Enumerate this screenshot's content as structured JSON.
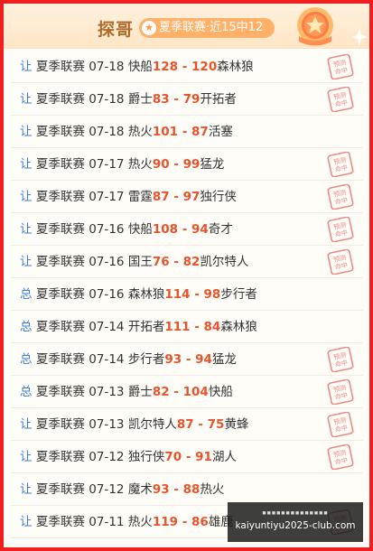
{
  "header": {
    "title": "探哥",
    "badge_text": "夏季联赛·近15中12",
    "colors": {
      "accent": "#ffb16a",
      "title": "#b06a2a",
      "score": "#e8532b",
      "tag": "#3d7dd6",
      "frame": "#f01e1e"
    }
  },
  "rows": [
    {
      "tag": "让",
      "league": "夏季联赛",
      "date": "07-18",
      "home": "快船",
      "home_score": "128",
      "sep": " - ",
      "away_score": "120",
      "away": "森林狼",
      "hit": true
    },
    {
      "tag": "让",
      "league": "夏季联赛",
      "date": "07-18",
      "home": "爵士",
      "home_score": "83",
      "sep": " - ",
      "away_score": "79",
      "away": "开拓者",
      "hit": true
    },
    {
      "tag": "让",
      "league": "夏季联赛",
      "date": "07-18",
      "home": "热火",
      "home_score": "101",
      "sep": " - ",
      "away_score": "87",
      "away": "活塞",
      "hit": false
    },
    {
      "tag": "让",
      "league": "夏季联赛",
      "date": "07-17",
      "home": "热火",
      "home_score": "90",
      "sep": " - ",
      "away_score": "99",
      "away": "猛龙",
      "hit": true
    },
    {
      "tag": "让",
      "league": "夏季联赛",
      "date": "07-17",
      "home": "雷霆",
      "home_score": "87",
      "sep": " - ",
      "away_score": "97",
      "away": "独行侠",
      "hit": true
    },
    {
      "tag": "让",
      "league": "夏季联赛",
      "date": "07-16",
      "home": "快船",
      "home_score": "108",
      "sep": " - ",
      "away_score": "94",
      "away": "奇才",
      "hit": true
    },
    {
      "tag": "让",
      "league": "夏季联赛",
      "date": "07-16",
      "home": "国王",
      "home_score": "76",
      "sep": " - ",
      "away_score": "82",
      "away": "凯尔特人",
      "hit": true
    },
    {
      "tag": "总",
      "league": "夏季联赛",
      "date": "07-16",
      "home": "森林狼",
      "home_score": "114",
      "sep": " - ",
      "away_score": "98",
      "away": "步行者",
      "hit": false
    },
    {
      "tag": "总",
      "league": "夏季联赛",
      "date": "07-14",
      "home": "开拓者",
      "home_score": "111",
      "sep": " - ",
      "away_score": "84",
      "away": "森林狼",
      "hit": false
    },
    {
      "tag": "总",
      "league": "夏季联赛",
      "date": "07-14",
      "home": "步行者",
      "home_score": "93",
      "sep": " - ",
      "away_score": "94",
      "away": "猛龙",
      "hit": true
    },
    {
      "tag": "总",
      "league": "夏季联赛",
      "date": "07-13",
      "home": "爵士",
      "home_score": "82",
      "sep": " - ",
      "away_score": "104",
      "away": "快船",
      "hit": true
    },
    {
      "tag": "让",
      "league": "夏季联赛",
      "date": "07-13",
      "home": "凯尔特人",
      "home_score": "87",
      "sep": " - ",
      "away_score": "75",
      "away": "黄蜂",
      "hit": true
    },
    {
      "tag": "让",
      "league": "夏季联赛",
      "date": "07-12",
      "home": "独行侠",
      "home_score": "70",
      "sep": " - ",
      "away_score": "91",
      "away": "湖人",
      "hit": true
    },
    {
      "tag": "让",
      "league": "夏季联赛",
      "date": "07-12",
      "home": "魔术",
      "home_score": "93",
      "sep": " - ",
      "away_score": "88",
      "away": "热火",
      "hit": false
    },
    {
      "tag": "让",
      "league": "夏季联赛",
      "date": "07-11",
      "home": "热火",
      "home_score": "119",
      "sep": " - ",
      "away_score": "86",
      "away": "雄鹿",
      "hit": true
    }
  ],
  "stamp": {
    "line1": "预测",
    "line2": "命中",
    "color": "#ec8a8a",
    "icon": "hit-stamp-icon"
  },
  "watermark": {
    "line1": "■■■■■■■■■■■■■■",
    "line2": "kaiyuntiyu2025-club.com"
  }
}
